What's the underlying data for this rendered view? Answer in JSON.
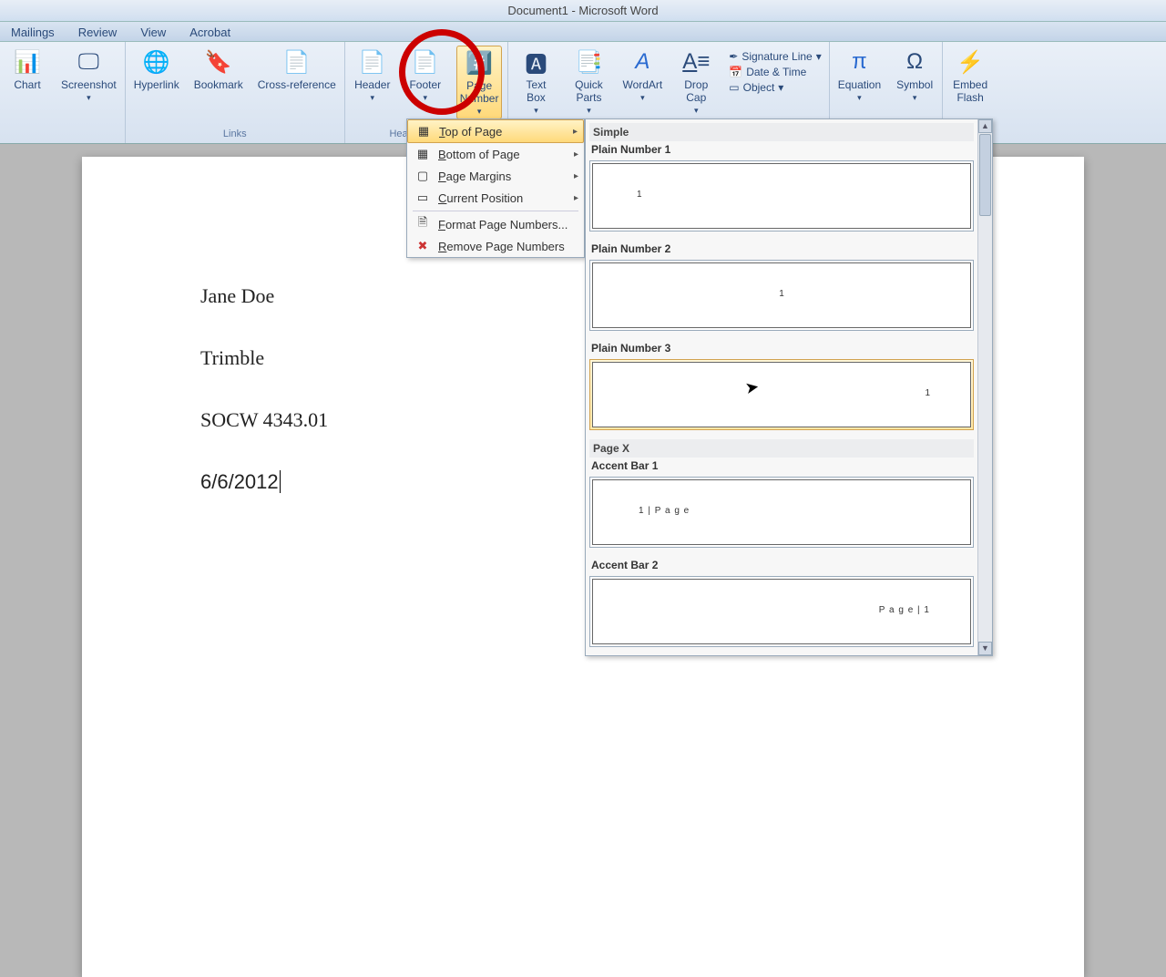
{
  "title": "Document1 - Microsoft Word",
  "tabs": {
    "mailings": "Mailings",
    "review": "Review",
    "view": "View",
    "acrobat": "Acrobat"
  },
  "ribbon": {
    "chart": "Chart",
    "screenshot": "Screenshot",
    "hyperlink": "Hyperlink",
    "bookmark": "Bookmark",
    "crossref": "Cross-reference",
    "links_label": "Links",
    "header": "Header",
    "footer": "Footer",
    "pagenumber": "Page\nNumber",
    "hf_label": "Header & Footer",
    "textbox": "Text\nBox",
    "quickparts": "Quick\nParts",
    "wordart": "WordArt",
    "dropcap": "Drop\nCap",
    "sigline": "Signature Line",
    "datetime": "Date & Time",
    "object": "Object",
    "equation": "Equation",
    "symbol": "Symbol",
    "embedflash": "Embed\nFlash"
  },
  "menu": {
    "top": "Top of Page",
    "bottom": "Bottom of Page",
    "margins": "Page Margins",
    "current": "Current Position",
    "format": "Format Page Numbers...",
    "remove": "Remove Page Numbers"
  },
  "gallery": {
    "simple": "Simple",
    "pn1": "Plain Number 1",
    "pn2": "Plain Number 2",
    "pn3": "Plain Number 3",
    "pagex": "Page X",
    "ab1": "Accent Bar 1",
    "ab2": "Accent Bar 2",
    "preview_num": "1",
    "preview_ab1": "1 | P a g e",
    "preview_ab2": "P a g e | 1"
  },
  "document": {
    "line1": "Jane Doe",
    "line2": "Trimble",
    "line3": "SOCW 4343.01",
    "line4": "6/6/2012"
  }
}
